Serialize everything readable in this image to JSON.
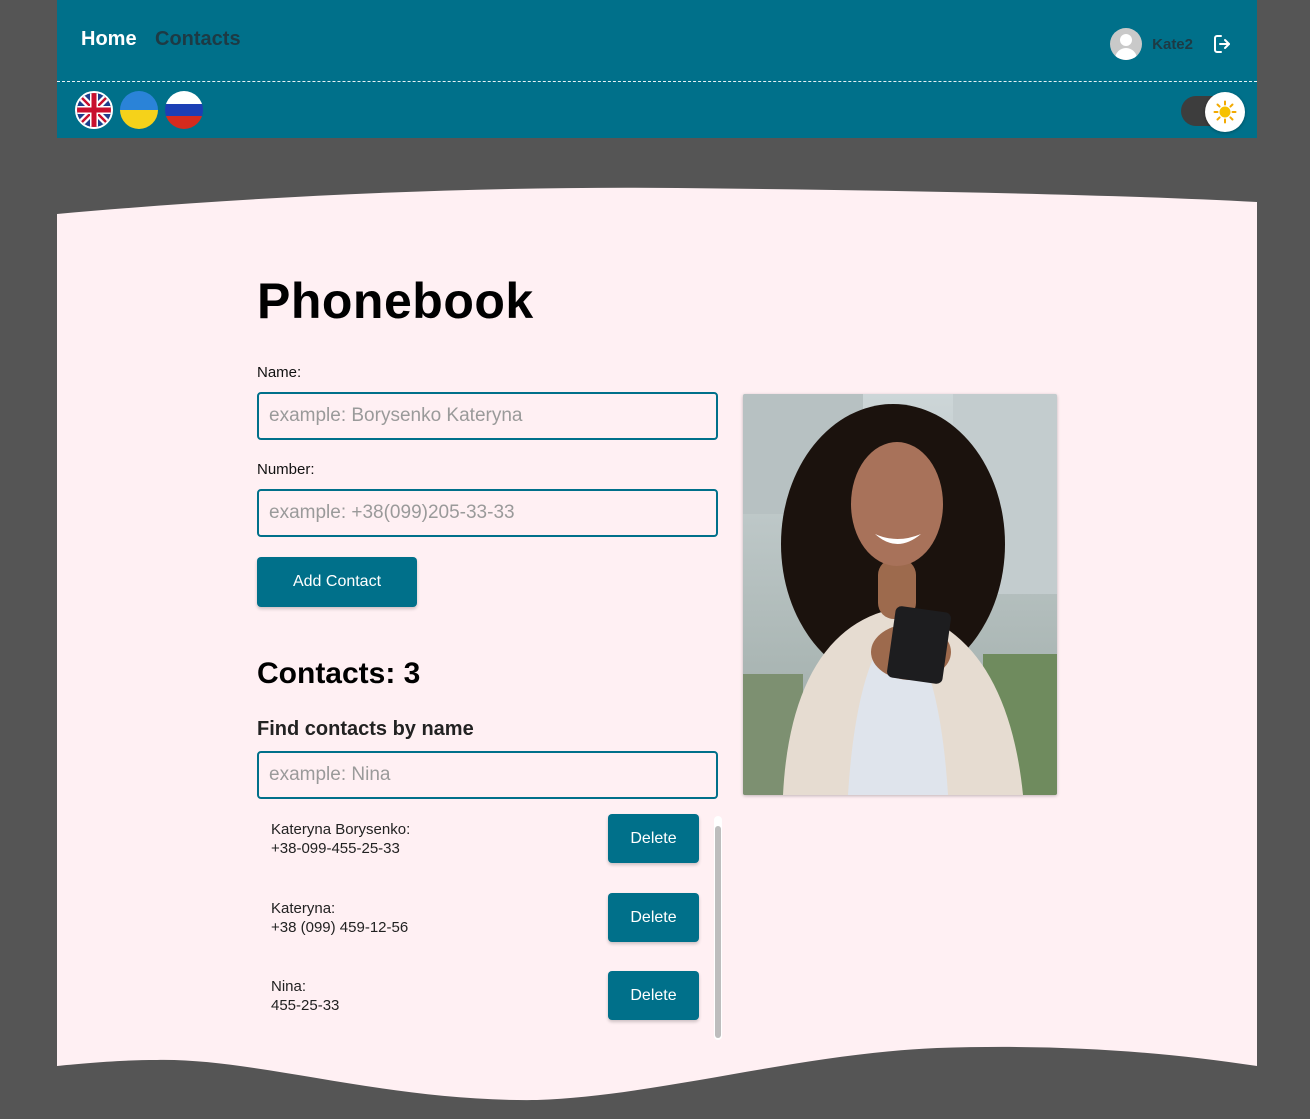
{
  "nav": {
    "home": "Home",
    "contacts": "Contacts",
    "user_name": "Kate2",
    "icons": [
      "avatar",
      "logout-icon",
      "flag-uk",
      "flag-ukraine",
      "flag-russia",
      "sun-icon"
    ]
  },
  "page": {
    "title": "Phonebook"
  },
  "form": {
    "name_label": "Name:",
    "name_placeholder": "example: Borysenko Kateryna",
    "number_label": "Number:",
    "number_placeholder": "example: +38(099)205-33-33",
    "add_button": "Add Contact"
  },
  "contacts": {
    "title": "Contacts: 3",
    "find_label": "Find contacts by name",
    "find_placeholder": "example: Nina",
    "items": [
      {
        "name": "Kateryna Borysenko:",
        "number": "+38-099-455-25-33",
        "delete": "Delete"
      },
      {
        "name": "Kateryna:",
        "number": "+38 (099) 459-12-56",
        "delete": "Delete"
      },
      {
        "name": "Nina:",
        "number": "455-25-33",
        "delete": "Delete"
      }
    ]
  },
  "colors": {
    "accent": "#00708a",
    "page_bg": "#555555",
    "content_bg": "#fff0f3"
  }
}
